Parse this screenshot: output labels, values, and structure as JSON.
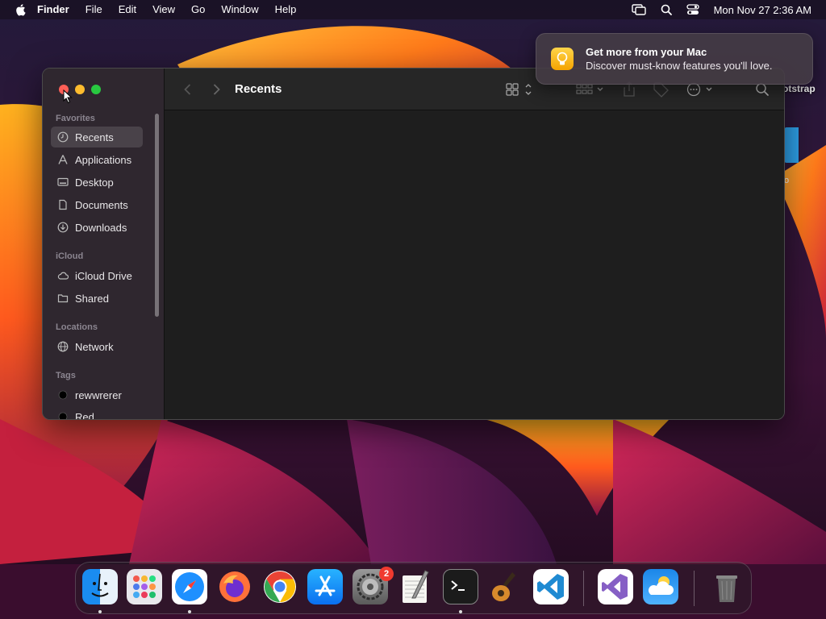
{
  "menubar": {
    "app_name": "Finder",
    "items": [
      "File",
      "Edit",
      "View",
      "Go",
      "Window",
      "Help"
    ],
    "clock": "Mon Nov 27  2:36 AM"
  },
  "desktop": {
    "partial_label": "otstrap",
    "partial_folder_label": "o"
  },
  "notification": {
    "title": "Get more from your Mac",
    "body": "Discover must-know features you'll love."
  },
  "finder": {
    "title": "Recents",
    "sidebar": {
      "sections": [
        {
          "label": "Favorites",
          "items": [
            "Recents",
            "Applications",
            "Desktop",
            "Documents",
            "Downloads"
          ]
        },
        {
          "label": "iCloud",
          "items": [
            "iCloud Drive",
            "Shared"
          ]
        },
        {
          "label": "Locations",
          "items": [
            "Network"
          ]
        },
        {
          "label": "Tags",
          "items": [
            "rewwrerer",
            "Red"
          ]
        }
      ]
    }
  },
  "dock": {
    "apps": [
      "Finder",
      "Launchpad",
      "Safari",
      "Firefox",
      "Chrome",
      "App Store",
      "System Settings",
      "TextEdit",
      "Terminal",
      "GarageBand",
      "Visual Studio Code",
      "Visual Studio",
      "Weather",
      "Trash"
    ],
    "system_settings_badge": "2"
  },
  "colors": {
    "window_bg": "#1e1e1e",
    "sidebar_bg": "#302830",
    "close": "#fe5f57",
    "minimize": "#febc2e",
    "maximize": "#28c840"
  }
}
